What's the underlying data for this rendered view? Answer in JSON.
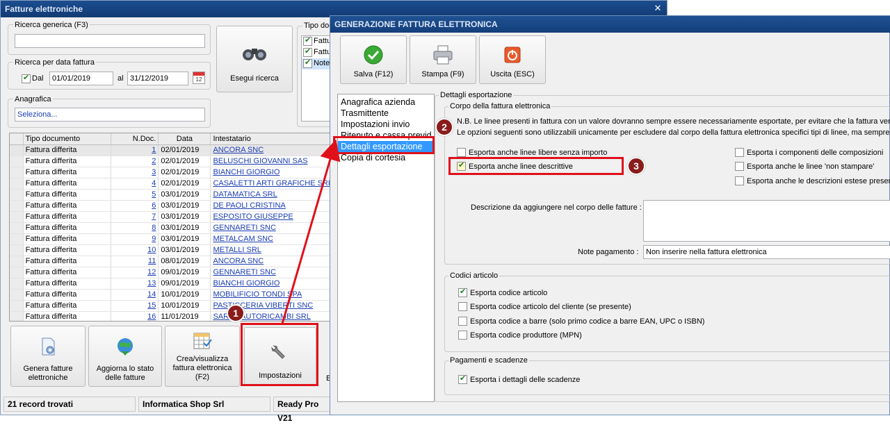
{
  "main": {
    "title": "Fatture elettroniche",
    "search": {
      "generic_label": "Ricerca generica (F3)",
      "generic_value": "",
      "date_label": "Ricerca per data fattura",
      "dal_label": "Dal",
      "date_from": "01/01/2019",
      "al_label": "al",
      "date_to": "31/12/2019",
      "anagrafica_label": "Anagrafica",
      "anagrafica_value": "Seleziona...",
      "search_button": "Esegui ricerca"
    },
    "tipo_doc": {
      "label": "Tipo doc",
      "items": [
        "Fattu",
        "Fattu",
        "Note"
      ]
    },
    "grid": {
      "headers": [
        "Tipo documento",
        "N.Doc.",
        "Data",
        "Intestatario"
      ],
      "rows": [
        [
          "Fattura differita",
          "1",
          "02/01/2019",
          "ANCORA SNC"
        ],
        [
          "Fattura differita",
          "2",
          "02/01/2019",
          "BELUSCHI GIOVANNI SAS"
        ],
        [
          "Fattura differita",
          "3",
          "02/01/2019",
          "BIANCHI GIORGIO"
        ],
        [
          "Fattura differita",
          "4",
          "02/01/2019",
          "CASALETTI ARTI GRAFICHE SRL"
        ],
        [
          "Fattura differita",
          "5",
          "03/01/2019",
          "DATAMATICA SRL"
        ],
        [
          "Fattura differita",
          "6",
          "03/01/2019",
          "DE PAOLI CRISTINA"
        ],
        [
          "Fattura differita",
          "7",
          "03/01/2019",
          "ESPOSITO GIUSEPPE"
        ],
        [
          "Fattura differita",
          "8",
          "03/01/2019",
          "GENNARETI SNC"
        ],
        [
          "Fattura differita",
          "9",
          "03/01/2019",
          "METALCAM SNC"
        ],
        [
          "Fattura differita",
          "10",
          "03/01/2019",
          "METALLI SRL"
        ],
        [
          "Fattura differita",
          "11",
          "08/01/2019",
          "ANCORA SNC"
        ],
        [
          "Fattura differita",
          "12",
          "09/01/2019",
          "GENNARETI SNC"
        ],
        [
          "Fattura differita",
          "13",
          "09/01/2019",
          "BIANCHI GIORGIO"
        ],
        [
          "Fattura differita",
          "14",
          "10/01/2019",
          "MOBILIFICIO TONDI SPA"
        ],
        [
          "Fattura differita",
          "15",
          "10/01/2019",
          "PASTICCERIA VIBERTI SNC"
        ],
        [
          "Fattura differita",
          "16",
          "11/01/2019",
          "SARDA AUTORICAMBI SRL"
        ]
      ]
    },
    "buttons": {
      "genera": "Genera fatture elettroniche",
      "aggiorna": "Aggiorna lo stato delle fatture",
      "crea": "Crea/visualizza fattura elettronica (F2)",
      "impostazioni": "Impostazioni",
      "partial": "E"
    },
    "status": {
      "records": "21 record trovati",
      "company": "Informatica Shop Srl",
      "app": "Ready Pro V21"
    }
  },
  "dialog": {
    "title": "GENERAZIONE FATTURA ELETTRONICA",
    "toolbar": {
      "save": "Salva (F12)",
      "print": "Stampa (F9)",
      "exit": "Uscita (ESC)"
    },
    "nav": [
      "Anagrafica azienda",
      "Trasmittente",
      "Impostazioni invio",
      "Ritenuto e cassa previd",
      "Dettagli esportazione",
      "Copia di cortesia"
    ],
    "nav_active": 4,
    "section_title": "Dettagli esportazione",
    "corpo": {
      "label": "Corpo della fattura elettronica",
      "note1": "N.B. Le linee presenti in fattura con un valore dovranno sempre essere necessariamente esportate, per evitare che la fattura ven",
      "note2": "Le opzioni seguenti sono utilizzabili unicamente per escludere dal corpo della fattura elettronica specifici tipi di linee, ma sempre e s",
      "left_options": [
        {
          "label": "Esporta anche linee libere senza importo",
          "checked": false
        },
        {
          "label": "Esporta anche linee descrittive",
          "checked": true
        }
      ],
      "right_options": [
        {
          "label": "Esporta i componenti delle composizioni",
          "checked": false
        },
        {
          "label": "Esporta anche le linee 'non stampare'",
          "checked": false
        },
        {
          "label": "Esporta anche le descrizioni estese present",
          "checked": false
        }
      ],
      "desc_label": "Descrizione da aggiungere nel corpo delle fatture :",
      "desc_value": "",
      "note_pag_label": "Note pagamento :",
      "note_pag_value": "Non inserire nella fattura elettronica"
    },
    "codici": {
      "label": "Codici articolo",
      "options": [
        {
          "label": "Esporta codice articolo",
          "checked": true
        },
        {
          "label": "Esporta codice articolo del cliente (se presente)",
          "checked": false
        },
        {
          "label": "Esporta codice a barre (solo primo codice a barre EAN, UPC o ISBN)",
          "checked": false
        },
        {
          "label": "Esporta codice produttore (MPN)",
          "checked": false
        }
      ]
    },
    "pagamenti": {
      "label": "Pagamenti e scadenze",
      "options": [
        {
          "label": "Esporta i dettagli delle scadenze",
          "checked": true
        }
      ]
    }
  },
  "annotations": {
    "badges": [
      "1",
      "2",
      "3"
    ],
    "color": "#e0101a"
  }
}
